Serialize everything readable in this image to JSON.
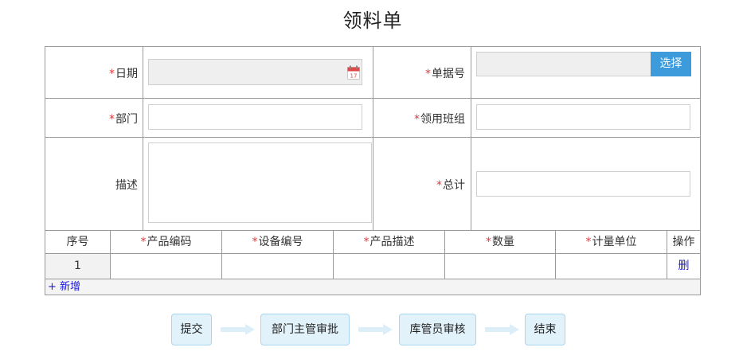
{
  "title": "领料单",
  "form": {
    "date_label": "日期",
    "doc_no_label": "单据号",
    "select_label": "选择",
    "dept_label": "部门",
    "team_label": "领用班组",
    "desc_label": "描述",
    "total_label": "总计",
    "required_mark": "*"
  },
  "table": {
    "headers": [
      {
        "text": "序号",
        "required": false
      },
      {
        "text": "产品编码",
        "required": true
      },
      {
        "text": "设备编号",
        "required": true
      },
      {
        "text": "产品描述",
        "required": true
      },
      {
        "text": "数量",
        "required": true
      },
      {
        "text": "计量单位",
        "required": true
      },
      {
        "text": "操作",
        "required": false
      }
    ],
    "rows": [
      {
        "index": "1",
        "action": "删"
      }
    ],
    "add_label": "+ 新增"
  },
  "workflow": {
    "steps": [
      "提交",
      "部门主管审批",
      "库管员审核",
      "结束"
    ]
  },
  "icons": {
    "date_picker": "calendar-icon",
    "flow_arrow": "right-arrow-icon"
  },
  "colors": {
    "required": "#e03a3a",
    "select_button": "#3d9bdc",
    "link": "#1a1adb",
    "step_bg": "#e2f2fb"
  }
}
